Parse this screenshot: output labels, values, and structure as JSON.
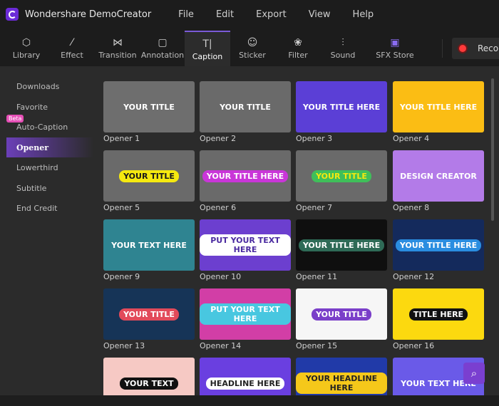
{
  "app": {
    "title": "Wondershare DemoCreator",
    "menu": [
      "File",
      "Edit",
      "Export",
      "View",
      "Help"
    ]
  },
  "toolbar": {
    "tools": [
      {
        "label": "Library",
        "icon": "cube-icon",
        "glyph": "⬡"
      },
      {
        "label": "Effect",
        "icon": "magic-wand-icon",
        "glyph": "⁄"
      },
      {
        "label": "Transition",
        "icon": "transition-icon",
        "glyph": "⋈"
      },
      {
        "label": "Annotation",
        "icon": "annotation-icon",
        "glyph": "▢"
      },
      {
        "label": "Caption",
        "icon": "text-icon",
        "glyph": "T|"
      },
      {
        "label": "Sticker",
        "icon": "smiley-icon",
        "glyph": "☺"
      },
      {
        "label": "Filter",
        "icon": "filter-icon",
        "glyph": "❀"
      },
      {
        "label": "Sound",
        "icon": "waveform-icon",
        "glyph": "⫶"
      },
      {
        "label": "SFX Store",
        "icon": "store-icon",
        "glyph": "▣"
      }
    ],
    "active": "Caption",
    "record_label": "Record"
  },
  "sidebar": {
    "items": [
      "Downloads",
      "Favorite",
      "Auto-Caption",
      "Opener",
      "Lowerthird",
      "Subtitle",
      "End Credit"
    ],
    "active": "Opener",
    "beta_badge": "Beta"
  },
  "grid": {
    "items": [
      {
        "label": "Opener 1",
        "text": "YOUR TITLE",
        "bg": "#6e6e6e",
        "fg": "#ffffff",
        "pill": ""
      },
      {
        "label": "Opener 2",
        "text": "YOUR TITLE",
        "bg": "#6a6a6a",
        "fg": "#ffffff",
        "pill": ""
      },
      {
        "label": "Opener 3",
        "text": "YOUR TITLE HERE",
        "bg": "#5b3fd6",
        "fg": "#ffffff",
        "pill": ""
      },
      {
        "label": "Opener 4",
        "text": "YOUR TITLE HERE",
        "bg": "#fbbd14",
        "fg": "#ffffff",
        "pill": ""
      },
      {
        "label": "Opener 5",
        "text": "YOUR TITLE",
        "bg": "#6a6a6a",
        "fg": "#1a1a1a",
        "pill": "#f5e90f"
      },
      {
        "label": "Opener 6",
        "text": "YOUR TITLE HERE",
        "bg": "#6a6a6a",
        "fg": "#ffffff",
        "pill": "#c936d8"
      },
      {
        "label": "Opener 7",
        "text": "YOUR TITLE",
        "bg": "#6a6a6a",
        "fg": "#f5e90f",
        "pill": "#3fbf5a"
      },
      {
        "label": "Opener 8",
        "text": "DESIGN CREATOR",
        "bg": "#b37be8",
        "fg": "#ffffff",
        "pill": ""
      },
      {
        "label": "Opener 9",
        "text": "YOUR TEXT HERE",
        "bg": "#2f8491",
        "fg": "#ffffff",
        "pill": ""
      },
      {
        "label": "Opener 10",
        "text": "PUT YOUR TEXT HERE",
        "bg": "#6c3fcf",
        "fg": "#4a2aa0",
        "pill": "#ffffff"
      },
      {
        "label": "Opener 11",
        "text": "YOUR TITLE HERE",
        "bg": "#0f0f0f",
        "fg": "#ffffff",
        "pill": "#2e6a56"
      },
      {
        "label": "Opener 12",
        "text": "YOUR TITLE HERE",
        "bg": "#142a5c",
        "fg": "#ffffff",
        "pill": "#2a8de0"
      },
      {
        "label": "Opener 13",
        "text": "YOUR TITLE",
        "bg": "#163457",
        "fg": "#ffffff",
        "pill": "#e24a5a"
      },
      {
        "label": "Opener 14",
        "text": "PUT YOUR TEXT HERE",
        "bg": "#d23ea6",
        "fg": "#ffffff",
        "pill": "#48c7e0"
      },
      {
        "label": "Opener 15",
        "text": "YOUR TITLE",
        "bg": "#f6f6f6",
        "fg": "#ffffff",
        "pill": "#7a3fc9"
      },
      {
        "label": "Opener 16",
        "text": "TITLE HERE",
        "bg": "#fcd90f",
        "fg": "#ffffff",
        "pill": "#111111"
      },
      {
        "label": "",
        "text": "YOUR TEXT",
        "bg": "#f6c9c4",
        "fg": "#ffffff",
        "pill": "#111111"
      },
      {
        "label": "",
        "text": "HEADLINE HERE",
        "bg": "#6a3fe0",
        "fg": "#222222",
        "pill": "#ffffff"
      },
      {
        "label": "",
        "text": "YOUR HEADLINE HERE",
        "bg": "#213aa8",
        "fg": "#222222",
        "pill": "#f5c81a"
      },
      {
        "label": "",
        "text": "YOUR TEXT HERE",
        "bg": "#6a5ae8",
        "fg": "#ffffff",
        "pill": ""
      }
    ]
  }
}
